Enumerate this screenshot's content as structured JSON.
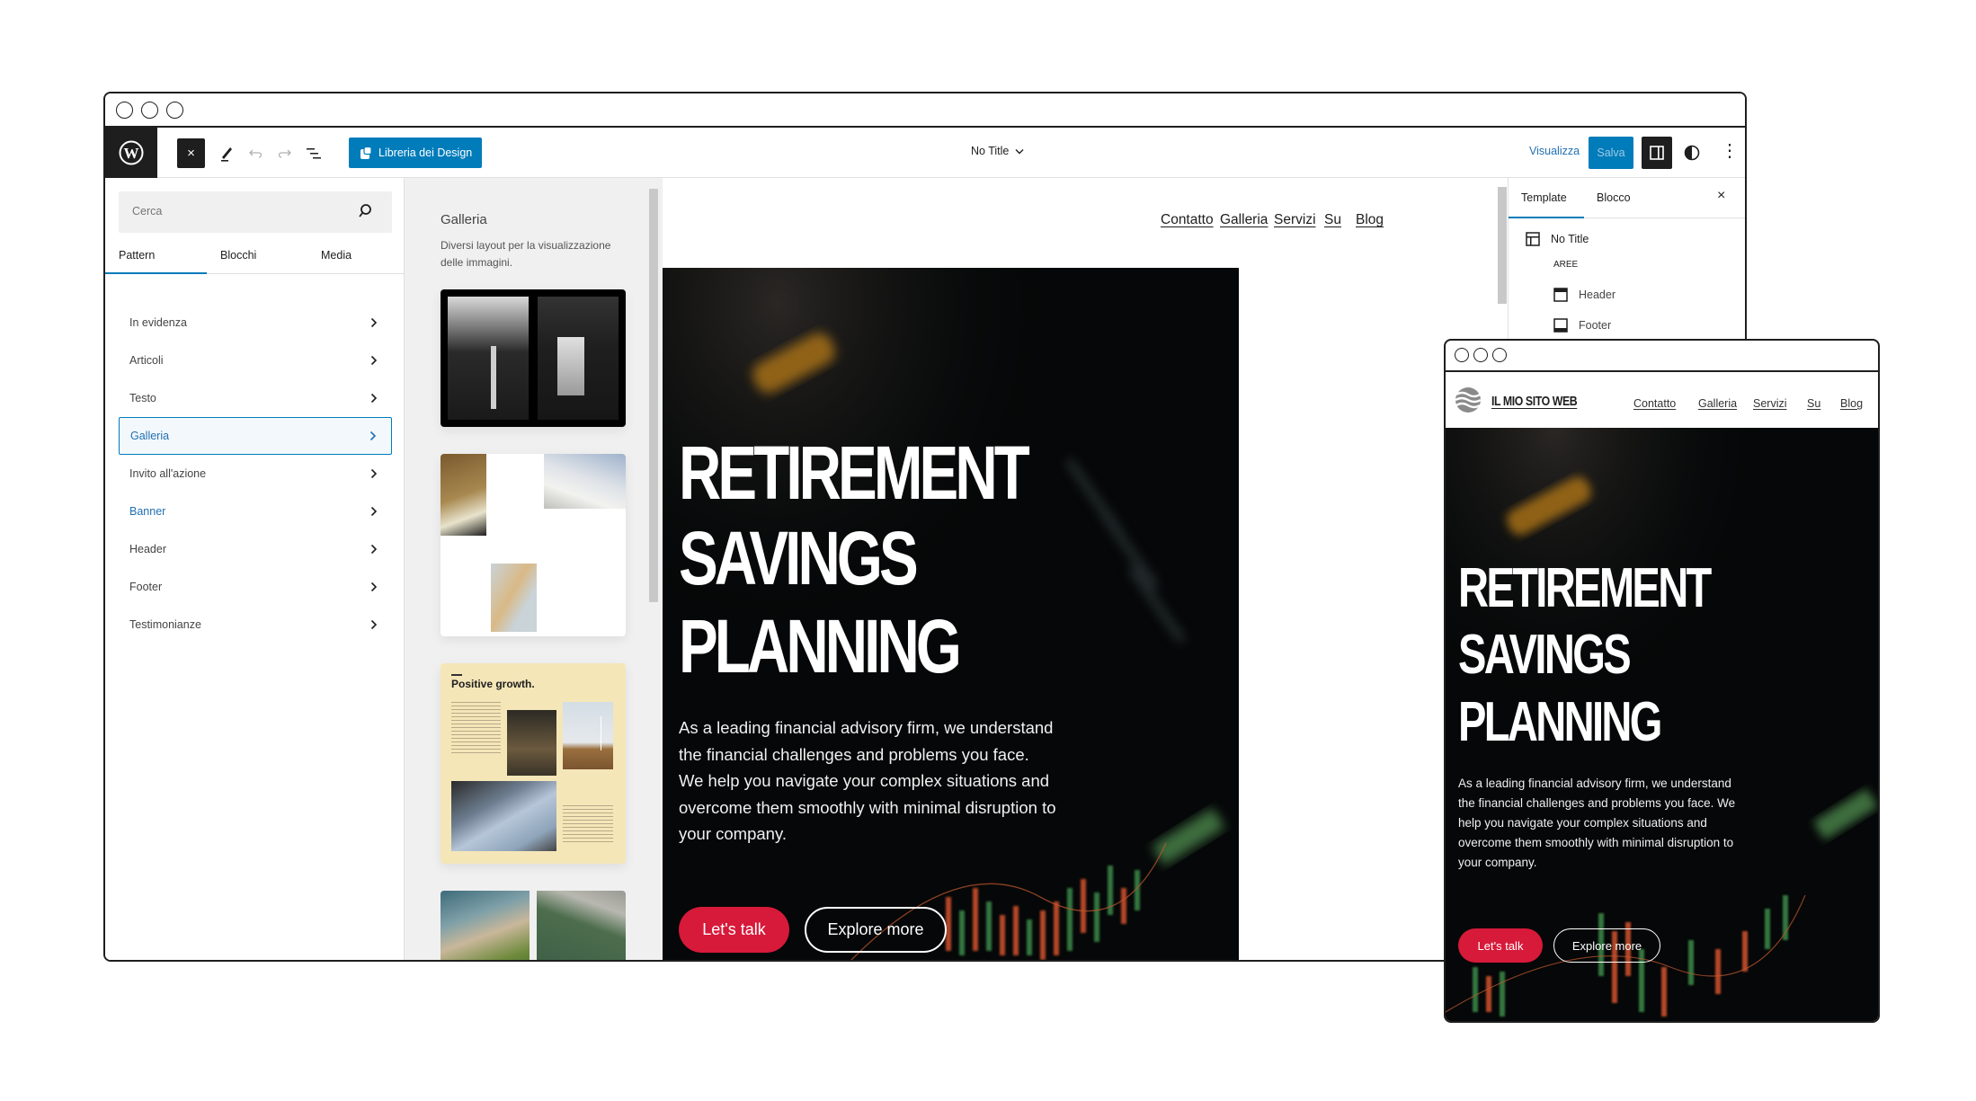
{
  "editor": {
    "toolbar": {
      "close_label": "×",
      "design_library_label": "Libreria dei Design",
      "document_title": "No Title",
      "preview_label": "Visualizza",
      "save_label": "Salva"
    },
    "left_sidebar": {
      "search_placeholder": "Cerca",
      "tabs": [
        {
          "label": "Pattern",
          "active": true
        },
        {
          "label": "Blocchi",
          "active": false
        },
        {
          "label": "Media",
          "active": false
        }
      ],
      "categories": [
        {
          "label": "In evidenza",
          "state": "normal"
        },
        {
          "label": "Articoli",
          "state": "normal"
        },
        {
          "label": "Testo",
          "state": "normal"
        },
        {
          "label": "Galleria",
          "state": "selected"
        },
        {
          "label": "Invito all'azione",
          "state": "normal"
        },
        {
          "label": "Banner",
          "state": "hover"
        },
        {
          "label": "Header",
          "state": "normal"
        },
        {
          "label": "Footer",
          "state": "normal"
        },
        {
          "label": "Testimonianze",
          "state": "normal"
        }
      ]
    },
    "pattern_panel": {
      "title": "Galleria",
      "description": "Diversi layout per la visualizzazione delle immagini.",
      "patterns": [
        {
          "name": "waterfall-gallery"
        },
        {
          "name": "architecture-offset-gallery"
        },
        {
          "name": "positive-growth-gallery",
          "heading": "Positive growth."
        },
        {
          "name": "aerial-gallery"
        }
      ]
    },
    "canvas": {
      "nav": [
        "Contatto",
        "Galleria",
        "Servizi",
        "Su",
        "Blog"
      ],
      "hero": {
        "title_lines": [
          "RETIREMENT",
          "SAVINGS",
          "PLANNING"
        ],
        "paragraph": "As a leading financial advisory firm, we understand the financial challenges and problems you face. We help you navigate your complex situations and overcome them smoothly with minimal disruption to your company.",
        "primary_button": "Let's talk",
        "secondary_button": "Explore more"
      }
    },
    "right_panel": {
      "tabs": [
        {
          "label": "Template",
          "active": true
        },
        {
          "label": "Blocco",
          "active": false
        }
      ],
      "close_label": "×",
      "template_name": "No Title",
      "areas_label": "AREE",
      "areas": [
        "Header",
        "Footer"
      ]
    }
  },
  "mobile_preview": {
    "site_title": "IL MIO SITO WEB",
    "nav": [
      "Contatto",
      "Galleria",
      "Servizi",
      "Su",
      "Blog"
    ],
    "hero": {
      "title_lines": [
        "RETIREMENT",
        "SAVINGS",
        "PLANNING"
      ],
      "paragraph": "As a leading financial advisory firm, we understand the financial challenges and problems you face. We help you navigate your complex situations and overcome them smoothly with minimal disruption to your company.",
      "primary_button": "Let's talk",
      "secondary_button": "Explore more"
    }
  },
  "colors": {
    "accent": "#007cba",
    "cta_red": "#d7193a",
    "hero_bg": "#050708",
    "pattern_cream": "#f5e6b8"
  }
}
